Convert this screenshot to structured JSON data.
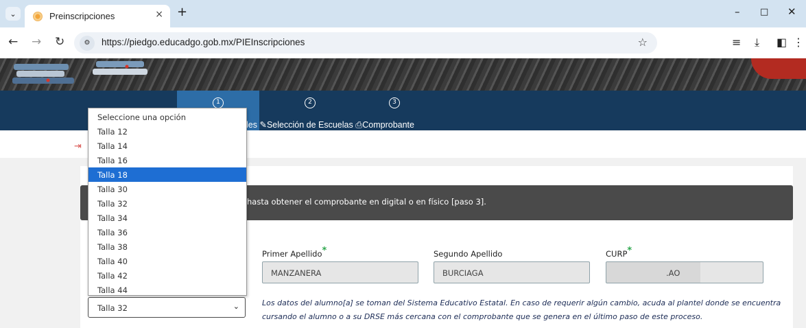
{
  "browser": {
    "tab_title": "Preinscripciones",
    "tab_close": "×",
    "new_tab": "+",
    "url": "https://piedgo.educadgo.gob.mx/PIEInscripciones",
    "minimize": "–",
    "maximize": "□",
    "close": "✕"
  },
  "stepper": {
    "steps": [
      {
        "number": "1",
        "label": "les"
      },
      {
        "number": "2",
        "label": "Selección de Escuelas"
      },
      {
        "number": "3",
        "label": "Comprobante"
      }
    ]
  },
  "alert": {
    "text": "hasta obtener el comprobante en digital o en físico [paso 3]."
  },
  "fields": {
    "primer_apellido": {
      "label": "Primer Apellido",
      "required": "*",
      "value": "MANZANERA"
    },
    "segundo_apellido": {
      "label": "Segundo Apellido",
      "value": "BURCIAGA"
    },
    "curp": {
      "label": "CURP",
      "required": "*",
      "value": ".AO"
    }
  },
  "note": {
    "line1": "Los datos del alumno[a] se toman del Sistema Educativo Estatal. En caso de requerir algún cambio, acuda al plantel donde se encuentra",
    "line2": "cursando el alumno o a su DRSE más cercana con el comprobante que se genera en el último paso de este proceso."
  },
  "size_select": {
    "selected_value": "Talla 32",
    "highlighted": "Talla 18",
    "options": [
      "Seleccione una opción",
      "Talla 12",
      "Talla 14",
      "Talla 16",
      "Talla 18",
      "Talla 30",
      "Talla 32",
      "Talla 34",
      "Talla 36",
      "Talla 38",
      "Talla 40",
      "Talla 42",
      "Talla 44"
    ]
  },
  "colors": {
    "stepbar": "#163a5d",
    "active_step": "#2d6da7",
    "highlight": "#1e6ed3",
    "required": "#2fa84f"
  }
}
